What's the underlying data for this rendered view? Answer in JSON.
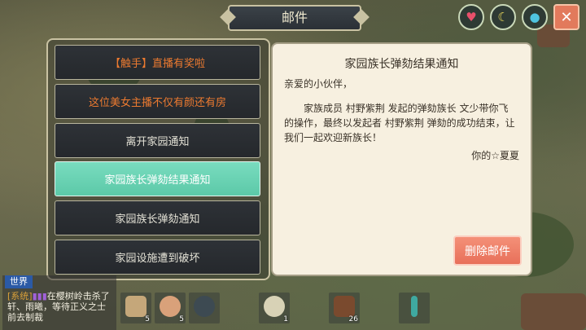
{
  "title": "邮件",
  "top_icons": {
    "heart": "heart-icon",
    "hunger": "banana-icon",
    "water": "water-drop-icon",
    "close_label": "✕"
  },
  "mail_list": [
    {
      "label": "【触手】直播有奖啦",
      "style": "promo"
    },
    {
      "label": "这位美女主播不仅有颜还有房",
      "style": "promo"
    },
    {
      "label": "离开家园通知",
      "style": "normal"
    },
    {
      "label": "家园族长弹劾结果通知",
      "style": "selected"
    },
    {
      "label": "家园族长弹劾通知",
      "style": "normal"
    },
    {
      "label": "家园设施遭到破坏",
      "style": "normal"
    }
  ],
  "mail_detail": {
    "title": "家园族长弹劾结果通知",
    "greeting": "亲爱的小伙伴，",
    "body": "家族成员 村野紫荆 发起的弹劾族长 文少带你飞 的操作，最终以发起者 村野紫荆 弹劾的成功结束，让我们一起欢迎新族长！",
    "signature": "你的☆夏夏",
    "delete_label": "删除邮件"
  },
  "chat": {
    "tab": "世界",
    "system_tag": "[系统]",
    "message": "在樱树岭击杀了轩、雨曦，等待正义之士前去制裁"
  },
  "hotbar": [
    {
      "icon": "cup-drink-icon",
      "count": "5"
    },
    {
      "icon": "food-bowl-icon",
      "count": "5"
    },
    {
      "icon": "helmet-icon",
      "count": ""
    },
    {
      "icon": "sack-icon",
      "count": "1"
    },
    {
      "icon": "vine-icon",
      "count": "26"
    },
    {
      "icon": "staff-icon",
      "count": ""
    }
  ],
  "colors": {
    "selected": "#6fd4b6",
    "promo_text": "#ec7a30",
    "delete_button": "#ee7c64",
    "panel_border": "#c9c2a2"
  }
}
